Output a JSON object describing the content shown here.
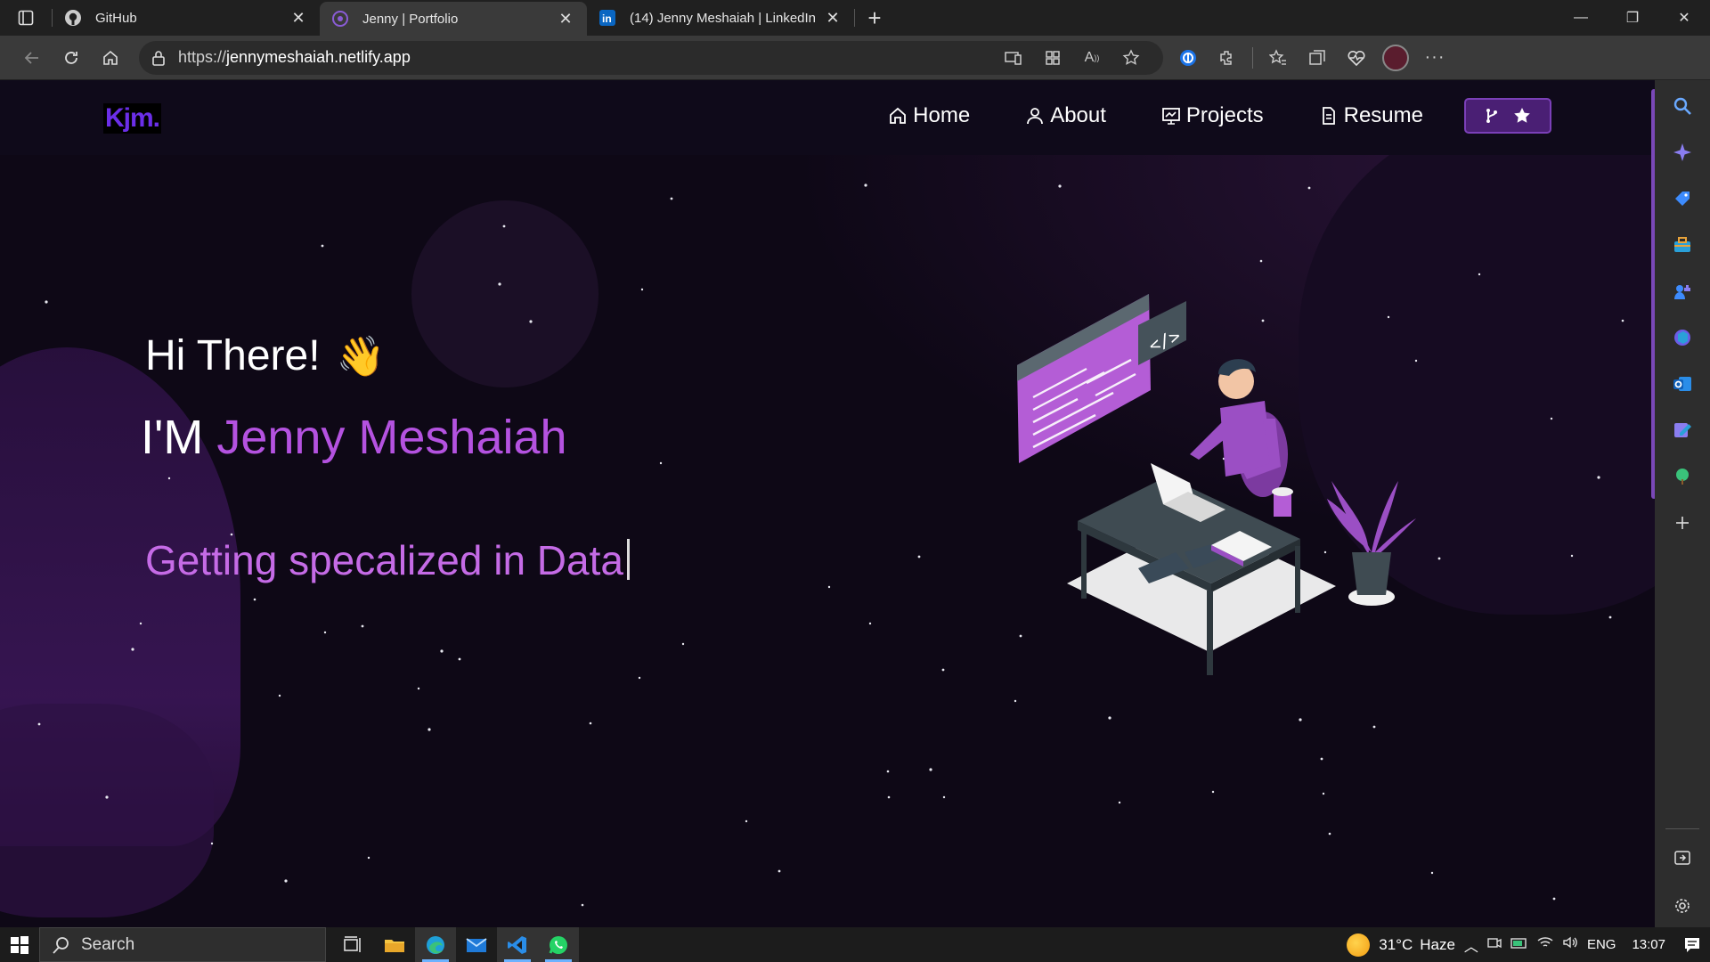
{
  "browser": {
    "tabs": [
      {
        "title": "GitHub",
        "icon": "github-icon",
        "active": false
      },
      {
        "title": "Jenny | Portfolio",
        "icon": "portfolio-icon",
        "active": true
      },
      {
        "title": "(14) Jenny Meshaiah | LinkedIn",
        "icon": "linkedin-icon",
        "active": false
      }
    ],
    "url_prefix": "https://",
    "url_host": "jennymeshaiah.netlify.app"
  },
  "site": {
    "logo": "Kjm.",
    "nav": [
      {
        "label": "Home",
        "icon": "home-icon"
      },
      {
        "label": "About",
        "icon": "user-icon"
      },
      {
        "label": "Projects",
        "icon": "projects-icon"
      },
      {
        "label": "Resume",
        "icon": "document-icon"
      }
    ],
    "github_button_icons": [
      "fork-icon",
      "star-icon"
    ],
    "greeting": "Hi There!",
    "wave_emoji": "👋",
    "intro_prefix": "I'M ",
    "intro_name": "Jenny Meshaiah",
    "typed_text": "Getting specalized in Data",
    "accent": "#b452e0"
  },
  "taskbar": {
    "search_placeholder": "Search",
    "weather": "31°C",
    "weather_desc": "Haze",
    "language": "ENG",
    "time": "13:07"
  }
}
